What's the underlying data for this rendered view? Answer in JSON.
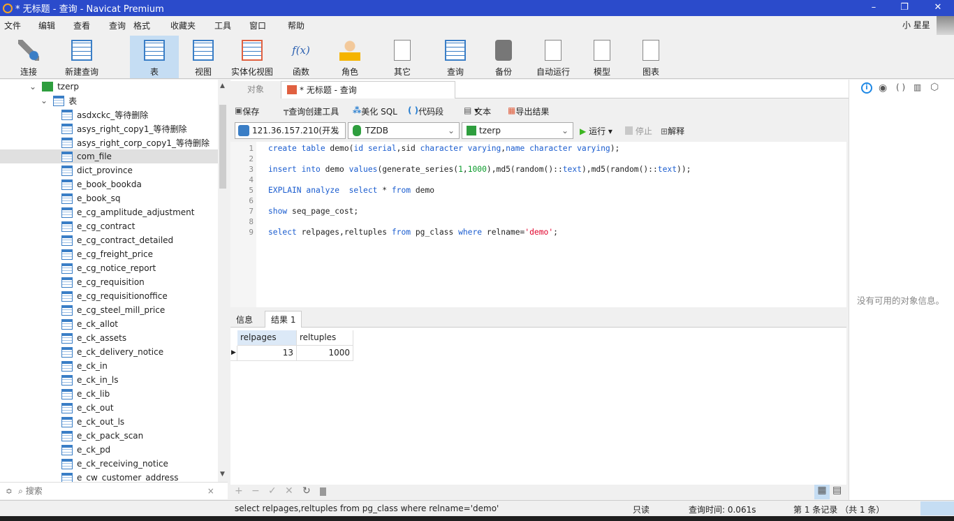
{
  "window": {
    "title": "* 无标题 - 查询 - Navicat Premium",
    "minimize": "–",
    "restore": "❐",
    "close": "✕"
  },
  "menu": [
    "文件",
    "编辑",
    "查看",
    "查询",
    "格式",
    "收藏夹",
    "工具",
    "窗口",
    "帮助"
  ],
  "user": {
    "name": "小 星星"
  },
  "toolbar": [
    {
      "label": "连接",
      "icon": "plug-icon"
    },
    {
      "label": "新建查询",
      "icon": "new-query-icon"
    },
    {
      "label": "表",
      "icon": "table-icon",
      "active": true
    },
    {
      "label": "视图",
      "icon": "view-icon"
    },
    {
      "label": "实体化视图",
      "icon": "materialized-view-icon"
    },
    {
      "label": "函数",
      "icon": "function-icon"
    },
    {
      "label": "角色",
      "icon": "user-icon"
    },
    {
      "label": "其它",
      "icon": "tools-icon"
    },
    {
      "label": "查询",
      "icon": "query-icon"
    },
    {
      "label": "备份",
      "icon": "backup-icon"
    },
    {
      "label": "自动运行",
      "icon": "schedule-icon"
    },
    {
      "label": "模型",
      "icon": "model-icon"
    },
    {
      "label": "图表",
      "icon": "chart-icon"
    }
  ],
  "tree": {
    "db": "tzerp",
    "group": "表",
    "selected": "com_file",
    "items": [
      "asdxckc_等待删除",
      "asys_right_copy1_等待删除",
      "asys_right_corp_copy1_等待删除",
      "com_file",
      "dict_province",
      "e_book_bookda",
      "e_book_sq",
      "e_cg_amplitude_adjustment",
      "e_cg_contract",
      "e_cg_contract_detailed",
      "e_cg_freight_price",
      "e_cg_notice_report",
      "e_cg_requisition",
      "e_cg_requisitionoffice",
      "e_cg_steel_mill_price",
      "e_ck_allot",
      "e_ck_assets",
      "e_ck_delivery_notice",
      "e_ck_in",
      "e_ck_in_ls",
      "e_ck_lib",
      "e_ck_out",
      "e_ck_out_ls",
      "e_ck_pack_scan",
      "e_ck_pd",
      "e_ck_receiving_notice",
      "e_cw_customer_address"
    ]
  },
  "search": {
    "placeholder": "搜索"
  },
  "tabs": {
    "objects": "对象",
    "query": "* 无标题 - 查询"
  },
  "qtools": {
    "save": "保存",
    "builder": "查询创建工具",
    "beautify": "美化 SQL",
    "snippet": "代码段",
    "text": "文本",
    "export": "导出结果",
    "run": "运行",
    "stop": "停止",
    "explain": "解释"
  },
  "selectors": {
    "connection": "121.36.157.210(开发",
    "database": "TZDB",
    "schema": "tzerp"
  },
  "code": [
    [
      [
        "kw",
        "create table "
      ],
      [
        "",
        "demo("
      ],
      [
        "kw",
        "id serial"
      ],
      [
        "",
        ",sid "
      ],
      [
        "kw",
        "character varying"
      ],
      [
        "",
        ","
      ],
      [
        "kw",
        "name character varying"
      ],
      [
        "",
        ");"
      ]
    ],
    [],
    [
      [
        "kw",
        "insert into "
      ],
      [
        "",
        "demo "
      ],
      [
        "kw",
        "values"
      ],
      [
        "",
        "(generate_series("
      ],
      [
        "num",
        "1"
      ],
      [
        "",
        ","
      ],
      [
        "num",
        "1000"
      ],
      [
        "",
        "),md5(random()::"
      ],
      [
        "kw",
        "text"
      ],
      [
        "",
        "),md5(random()::"
      ],
      [
        "kw",
        "text"
      ],
      [
        "",
        "));"
      ]
    ],
    [],
    [
      [
        "kw",
        "EXPLAIN analyze  select "
      ],
      [
        "",
        "* "
      ],
      [
        "kw",
        "from "
      ],
      [
        "",
        "demo"
      ]
    ],
    [],
    [
      [
        "kw",
        "show "
      ],
      [
        "",
        "seq_page_cost;"
      ]
    ],
    [],
    [
      [
        "kw",
        "select "
      ],
      [
        "",
        "relpages,reltuples "
      ],
      [
        "kw",
        "from "
      ],
      [
        "",
        "pg_class "
      ],
      [
        "kw",
        "where "
      ],
      [
        "",
        "relname="
      ],
      [
        "str",
        "'demo'"
      ],
      [
        "",
        ";"
      ]
    ]
  ],
  "results": {
    "tabs": [
      "信息",
      "结果 1"
    ],
    "columns": [
      "relpages",
      "reltuples"
    ],
    "rows": [
      [
        "13",
        "1000"
      ]
    ]
  },
  "right_panel": {
    "empty": "没有可用的对象信息。"
  },
  "status": {
    "sql": "select relpages,reltuples from pg_class where relname='demo'",
    "mode": "只读",
    "time": "查询时间: 0.061s",
    "records": "第 1 条记录 （共 1 条）"
  }
}
